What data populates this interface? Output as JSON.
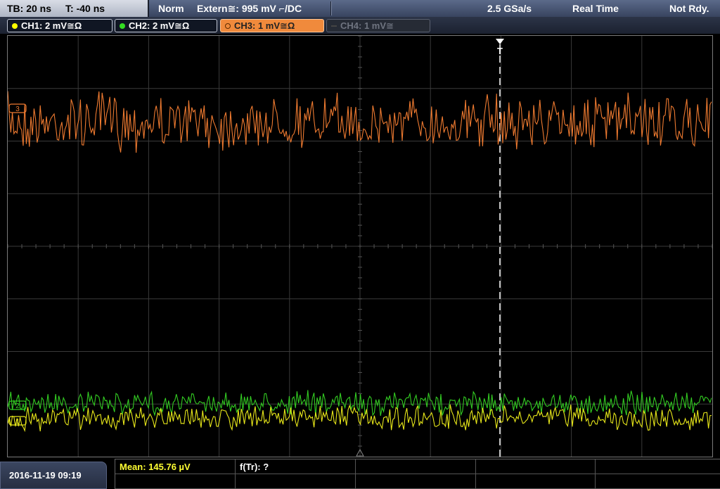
{
  "status_bar": {
    "timebase": "TB: 20 ns",
    "trigger_time": "T: -40 ns",
    "trigger_mode": "Norm",
    "trigger_source": "Extern≅: 995 mV ⌐/DC",
    "sample_rate": "2.5 GSa/s",
    "acquisition": "Real Time",
    "ready_state": "Not Rdy."
  },
  "channels": [
    {
      "label": "CH1: 2 mV≅Ω",
      "color": "#ffff00",
      "active": true
    },
    {
      "label": "CH2: 2 mV≅Ω",
      "color": "#33dd22",
      "active": true
    },
    {
      "label": "CH3: 1 mV≅Ω",
      "color": "#f07f2e",
      "active": true,
      "selected": true
    },
    {
      "label": "CH4: 1 mV≅",
      "color": "#555a66",
      "active": false
    }
  ],
  "display": {
    "trigger_marker": "T",
    "channel_markers": [
      "3",
      "2",
      "1"
    ],
    "colors": {
      "ch1_trace": "#e8e81a",
      "ch2_trace": "#33cc22",
      "ch3_trace": "#ee7a30",
      "grid": "#3a3a3a",
      "trigger_line": "#ffffff"
    }
  },
  "measurements": {
    "mean": "Mean: 145.76 µV",
    "freq": "f(Tr): ?"
  },
  "datetime": "2016-11-19 09:19"
}
